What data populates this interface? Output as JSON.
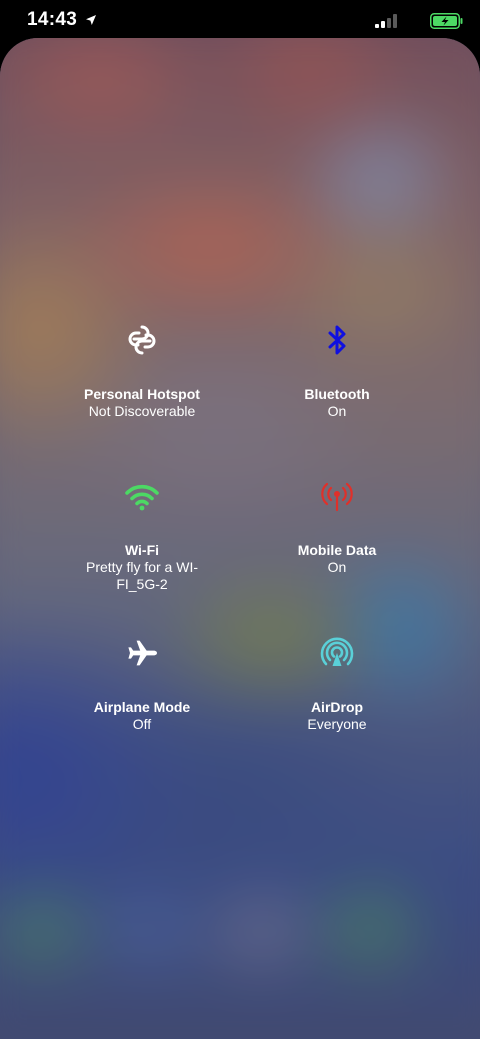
{
  "status_bar": {
    "time": "14:43",
    "signal_bars_active": 2,
    "signal_bars_total": 4
  },
  "colors": {
    "bluetooth": "#1010e0",
    "wifi": "#4cd964",
    "mobile_data": "#e0302a",
    "airdrop": "#5ad0d8",
    "battery_charge": "#4cd964"
  },
  "tiles": [
    {
      "label": "Personal Hotspot",
      "sub": "Not Discoverable",
      "icon": "hotspot-icon"
    },
    {
      "label": "Bluetooth",
      "sub": "On",
      "icon": "bluetooth-icon"
    },
    {
      "label": "Wi-Fi",
      "sub": "Pretty fly for a WI-FI_5G-2",
      "icon": "wifi-icon"
    },
    {
      "label": "Mobile Data",
      "sub": "On",
      "icon": "antenna-icon"
    },
    {
      "label": "Airplane Mode",
      "sub": "Off",
      "icon": "airplane-icon"
    },
    {
      "label": "AirDrop",
      "sub": "Everyone",
      "icon": "airdrop-icon"
    }
  ]
}
